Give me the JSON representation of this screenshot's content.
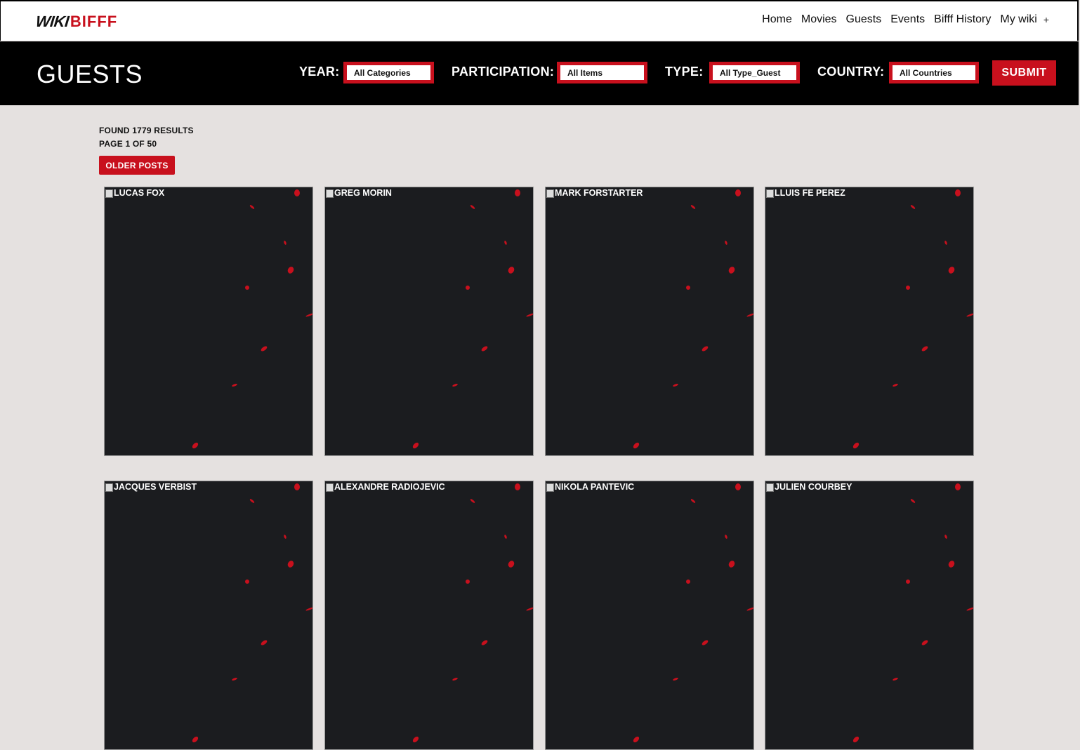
{
  "brand": {
    "logo_left": "WIKI",
    "logo_right": "BIFFF"
  },
  "nav": {
    "items": [
      "Home",
      "Movies",
      "Guests",
      "Events",
      "Bifff History",
      "My wiki"
    ],
    "plus": "+"
  },
  "filters": {
    "title": "GUESTS",
    "year_label": "YEAR:",
    "year_value": "All Categories",
    "participation_label": "PARTICIPATION:",
    "participation_value": "All Items",
    "type_label": "TYPE:",
    "type_value": "All Type_Guest",
    "country_label": "COUNTRY:",
    "country_value": "All Countries",
    "submit_label": "SUBMIT"
  },
  "results": {
    "found": "FOUND 1779 RESULTS",
    "page": "PAGE 1 OF 50",
    "older_label": "OLDER POSTS"
  },
  "guests": [
    "LUCAS FOX",
    "GREG MORIN",
    "MARK FORSTARTER",
    "LLUIS FE PEREZ",
    "JACQUES VERBIST",
    "ALEXANDRE RADIOJEVIC",
    "NIKOLA PANTEVIC",
    "JULIEN COURBEY"
  ],
  "colors": {
    "accent": "#c8101d",
    "card_bg": "#1b1c1f",
    "page_bg": "#e5e1e0"
  }
}
